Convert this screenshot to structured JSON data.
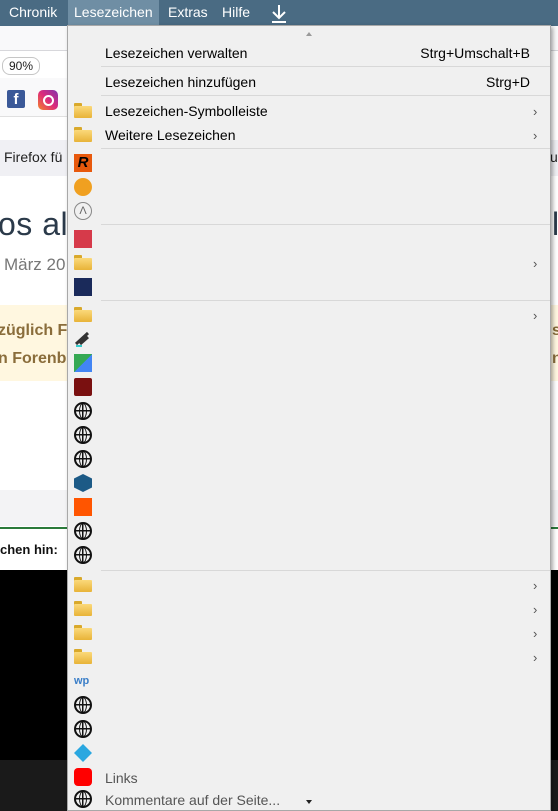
{
  "menubar": {
    "items": [
      "Chronik",
      "Lesezeichen",
      "Extras",
      "Hilfe"
    ],
    "active": "Lesezeichen"
  },
  "page": {
    "zoom": "90%",
    "notice_text": "Firefox fü",
    "notice_right": "u",
    "heading": "os als",
    "heading_right": "l",
    "date": "März 20",
    "highlight_line1": "züglich F",
    "highlight_line2": "n Forenb",
    "highlight_right1": "s",
    "highlight_right2": "n",
    "comment_text": "chen hin:"
  },
  "menu": {
    "manage": {
      "label": "Lesezeichen verwalten",
      "shortcut": "Strg+Umschalt+B"
    },
    "add": {
      "label": "Lesezeichen hinzufügen",
      "shortcut": "Strg+D"
    },
    "toolbar_folder": "Lesezeichen-Symbolleiste",
    "other_folder": "Weitere Lesezeichen",
    "bottom_partial": "Links",
    "bottom_partial2": "Kommentare auf der Seite..."
  },
  "colors": {
    "menubar": "#4a6b83",
    "menu_bg": "#f0f0f0",
    "folder": "#f2c14e"
  }
}
